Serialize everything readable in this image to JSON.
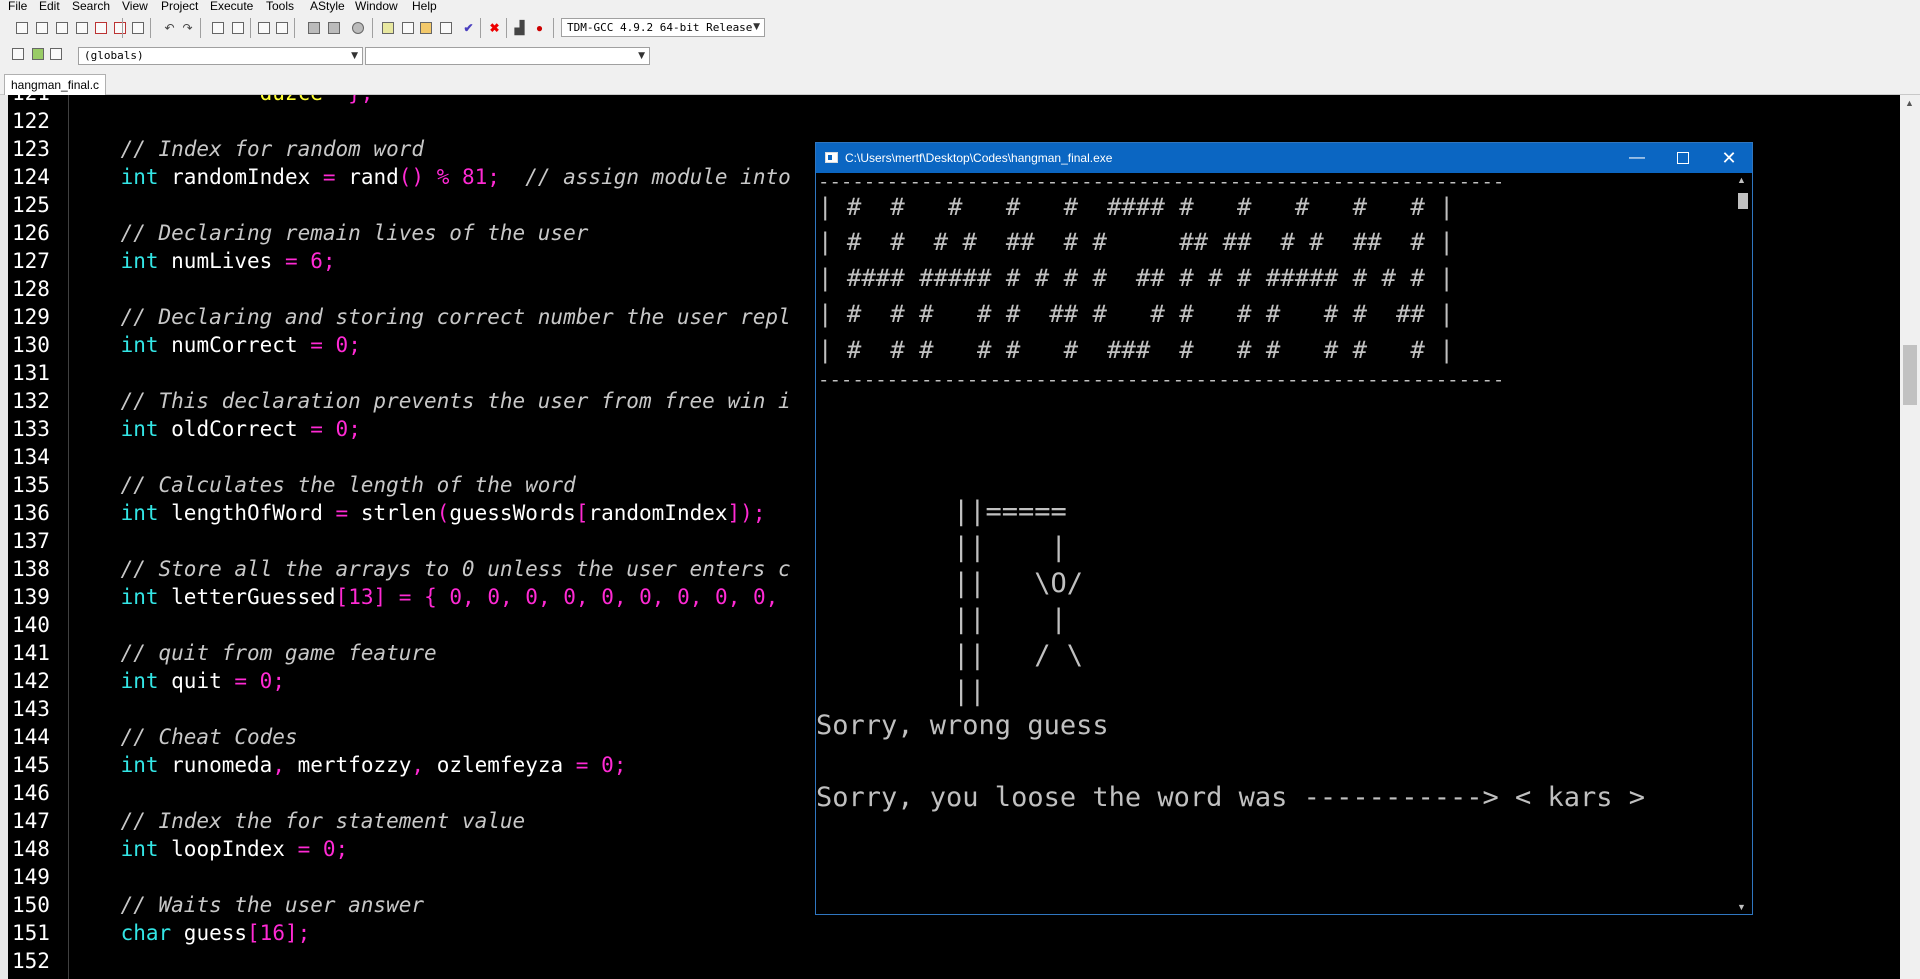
{
  "menu": [
    "File",
    "Edit",
    "Search",
    "View",
    "Project",
    "Execute",
    "Tools",
    "AStyle",
    "Window",
    "Help"
  ],
  "toolbar": {
    "compiler_select": "TDM-GCC 4.9.2 64-bit Release",
    "scope_select": "(globals)",
    "member_select": ""
  },
  "tabs": [
    {
      "label": "hangman_final.c"
    }
  ],
  "editor": {
    "lines": [
      {
        "n": "121",
        "parts": [
          [
            "str",
            "              \"duzce\""
          ],
          [
            "br",
            " };"
          ]
        ]
      },
      {
        "n": "122",
        "parts": []
      },
      {
        "n": "123",
        "parts": [
          [
            "cmt",
            "    // Index for random word"
          ]
        ]
      },
      {
        "n": "124",
        "parts": [
          [
            "kw",
            "    int"
          ],
          [
            "id",
            " randomIndex "
          ],
          [
            "op",
            "="
          ],
          [
            "id",
            " rand"
          ],
          [
            "br",
            "()"
          ],
          [
            "op",
            " % "
          ],
          [
            "num",
            "81"
          ],
          [
            "op",
            ";"
          ],
          [
            "cmt",
            "  // assign module into"
          ]
        ]
      },
      {
        "n": "125",
        "parts": []
      },
      {
        "n": "126",
        "parts": [
          [
            "cmt",
            "    // Declaring remain lives of the user"
          ]
        ]
      },
      {
        "n": "127",
        "parts": [
          [
            "kw",
            "    int"
          ],
          [
            "id",
            " numLives "
          ],
          [
            "op",
            "="
          ],
          [
            "num",
            " 6"
          ],
          [
            "op",
            ";"
          ]
        ]
      },
      {
        "n": "128",
        "parts": []
      },
      {
        "n": "129",
        "parts": [
          [
            "cmt",
            "    // Declaring and storing correct number the user repl"
          ]
        ]
      },
      {
        "n": "130",
        "parts": [
          [
            "kw",
            "    int"
          ],
          [
            "id",
            " numCorrect "
          ],
          [
            "op",
            "="
          ],
          [
            "num",
            " 0"
          ],
          [
            "op",
            ";"
          ]
        ]
      },
      {
        "n": "131",
        "parts": []
      },
      {
        "n": "132",
        "parts": [
          [
            "cmt",
            "    // This declaration prevents the user from free win i"
          ]
        ]
      },
      {
        "n": "133",
        "parts": [
          [
            "kw",
            "    int"
          ],
          [
            "id",
            " oldCorrect "
          ],
          [
            "op",
            "="
          ],
          [
            "num",
            " 0"
          ],
          [
            "op",
            ";"
          ]
        ]
      },
      {
        "n": "134",
        "parts": []
      },
      {
        "n": "135",
        "parts": [
          [
            "cmt",
            "    // Calculates the length of the word"
          ]
        ]
      },
      {
        "n": "136",
        "parts": [
          [
            "kw",
            "    int"
          ],
          [
            "id",
            " lengthOfWord "
          ],
          [
            "op",
            "="
          ],
          [
            "id",
            " strlen"
          ],
          [
            "br",
            "("
          ],
          [
            "id",
            "guessWords"
          ],
          [
            "br",
            "["
          ],
          [
            "id",
            "randomIndex"
          ],
          [
            "br",
            "])"
          ],
          [
            "op",
            ";"
          ]
        ]
      },
      {
        "n": "137",
        "parts": []
      },
      {
        "n": "138",
        "parts": [
          [
            "cmt",
            "    // Store all the arrays to 0 unless the user enters c"
          ]
        ]
      },
      {
        "n": "139",
        "parts": [
          [
            "kw",
            "    int"
          ],
          [
            "id",
            " letterGuessed"
          ],
          [
            "br",
            "["
          ],
          [
            "num",
            "13"
          ],
          [
            "br",
            "]"
          ],
          [
            "op",
            " ="
          ],
          [
            "br",
            " {"
          ],
          [
            "num",
            " 0"
          ],
          [
            "op",
            ","
          ],
          [
            "num",
            " 0"
          ],
          [
            "op",
            ","
          ],
          [
            "num",
            " 0"
          ],
          [
            "op",
            ","
          ],
          [
            "num",
            " 0"
          ],
          [
            "op",
            ","
          ],
          [
            "num",
            " 0"
          ],
          [
            "op",
            ","
          ],
          [
            "num",
            " 0"
          ],
          [
            "op",
            ","
          ],
          [
            "num",
            " 0"
          ],
          [
            "op",
            ","
          ],
          [
            "num",
            " 0"
          ],
          [
            "op",
            ","
          ],
          [
            "num",
            " 0"
          ],
          [
            "op",
            ","
          ]
        ]
      },
      {
        "n": "140",
        "parts": []
      },
      {
        "n": "141",
        "parts": [
          [
            "cmt",
            "    // quit from game feature"
          ]
        ]
      },
      {
        "n": "142",
        "parts": [
          [
            "kw",
            "    int"
          ],
          [
            "id",
            " quit "
          ],
          [
            "op",
            "="
          ],
          [
            "num",
            " 0"
          ],
          [
            "op",
            ";"
          ]
        ]
      },
      {
        "n": "143",
        "parts": []
      },
      {
        "n": "144",
        "parts": [
          [
            "cmt",
            "    // Cheat Codes"
          ]
        ]
      },
      {
        "n": "145",
        "parts": [
          [
            "kw",
            "    int"
          ],
          [
            "id",
            " runomeda"
          ],
          [
            "op",
            ","
          ],
          [
            "id",
            " mertfozzy"
          ],
          [
            "op",
            ","
          ],
          [
            "id",
            " ozlemfeyza "
          ],
          [
            "op",
            "="
          ],
          [
            "num",
            " 0"
          ],
          [
            "op",
            ";"
          ]
        ]
      },
      {
        "n": "146",
        "parts": []
      },
      {
        "n": "147",
        "parts": [
          [
            "cmt",
            "    // Index the for statement value"
          ]
        ]
      },
      {
        "n": "148",
        "parts": [
          [
            "kw",
            "    int"
          ],
          [
            "id",
            " loopIndex "
          ],
          [
            "op",
            "="
          ],
          [
            "num",
            " 0"
          ],
          [
            "op",
            ";"
          ]
        ]
      },
      {
        "n": "149",
        "parts": []
      },
      {
        "n": "150",
        "parts": [
          [
            "cmt",
            "    // Waits the user answer"
          ]
        ]
      },
      {
        "n": "151",
        "parts": [
          [
            "kw",
            "    char"
          ],
          [
            "id",
            " guess"
          ],
          [
            "br",
            "["
          ],
          [
            "num",
            "16"
          ],
          [
            "br",
            "]"
          ],
          [
            "op",
            ";"
          ]
        ]
      },
      {
        "n": "152",
        "parts": []
      }
    ]
  },
  "console": {
    "title": "C:\\Users\\mertf\\Desktop\\Codes\\hangman_final.exe",
    "banner": [
      "------------------------------------------------------------",
      "| #  #   #   #   #  #### #   #   #   #   # |",
      "| #  #  # #  ##  # #     ## ##  # #  ##  # |",
      "| #### ##### # # # #  ## # # # ##### # # # |",
      "| #  # #   # #  ## #   # #   # #   # #  ## |",
      "| #  # #   # #   #  ###  #   # #   # #   # |",
      "------------------------------------------------------------"
    ],
    "gallows": [
      "||=====",
      "||    |",
      "||   \\O/",
      "||    |",
      "||   / \\",
      "||"
    ],
    "message1": "Sorry, wrong guess",
    "message2": "Sorry, you loose the word was -----------> < kars >"
  }
}
